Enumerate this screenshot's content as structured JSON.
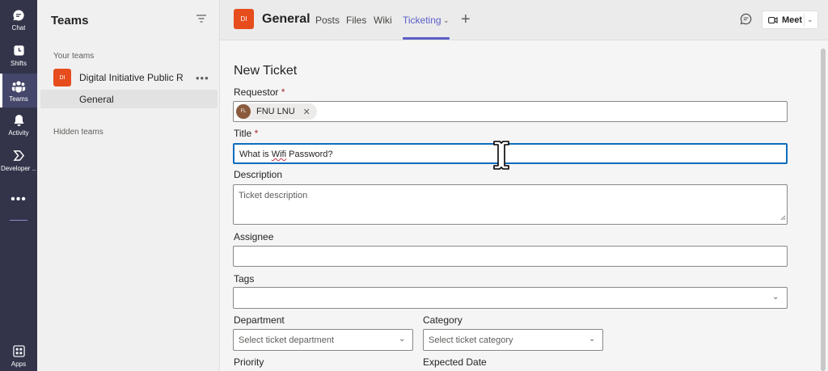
{
  "rail": {
    "items": [
      {
        "label": "Chat",
        "icon": "chat-icon"
      },
      {
        "label": "Shifts",
        "icon": "shifts-icon"
      },
      {
        "label": "Teams",
        "icon": "teams-icon"
      },
      {
        "label": "Activity",
        "icon": "bell-icon"
      },
      {
        "label": "Developer ...",
        "icon": "developer-portal-icon"
      },
      {
        "label": "Apps",
        "icon": "apps-icon"
      }
    ],
    "more": "•••"
  },
  "teams_panel": {
    "title": "Teams",
    "your_teams_label": "Your teams",
    "team": {
      "avatar": "DI",
      "name": "Digital Initiative Public R...",
      "more": "•••"
    },
    "channel": "General",
    "hidden_teams_label": "Hidden teams"
  },
  "header": {
    "avatar": "DI",
    "channel_title": "General",
    "tabs": [
      "Posts",
      "Files",
      "Wiki",
      "Ticketing"
    ],
    "active_tab": "Ticketing",
    "meet_label": "Meet"
  },
  "form": {
    "title": "New Ticket",
    "requestor": {
      "label": "Requestor",
      "required_mark": "*",
      "chip_initials": "FL",
      "chip_name": "FNU LNU"
    },
    "title_field": {
      "label": "Title",
      "required_mark": "*",
      "value_prefix": "What is ",
      "value_misspelled": "Wifi",
      "value_suffix": " Password?"
    },
    "description": {
      "label": "Description",
      "placeholder": "Ticket description"
    },
    "assignee": {
      "label": "Assignee",
      "value": ""
    },
    "tags": {
      "label": "Tags",
      "value": ""
    },
    "department": {
      "label": "Department",
      "placeholder": "Select ticket department"
    },
    "category": {
      "label": "Category",
      "placeholder": "Select ticket category"
    },
    "priority": {
      "label": "Priority"
    },
    "expected_date": {
      "label": "Expected Date"
    }
  },
  "colors": {
    "rail_bg": "#33344a",
    "accent": "#5b5fc7",
    "team_avatar": "#e74c1c",
    "focus_border": "#0f6cbd"
  }
}
